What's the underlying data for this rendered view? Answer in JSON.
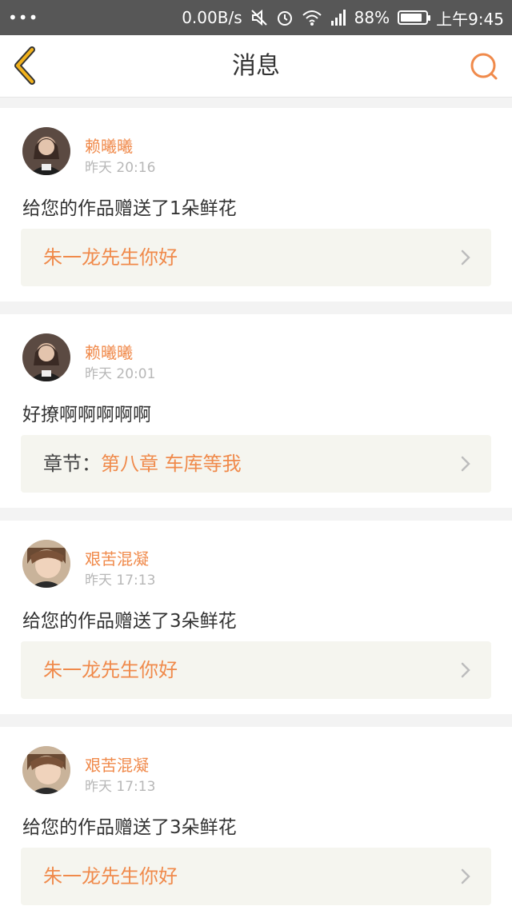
{
  "status_bar": {
    "dots": "•••",
    "network_speed": "0.00B/s",
    "battery_percent": "88%",
    "battery_level": 0.88,
    "time": "上午9:45"
  },
  "header": {
    "title": "消息"
  },
  "colors": {
    "accent": "#f08a4b",
    "back_arrow": "#f2b21c"
  },
  "messages": [
    {
      "username": "赖曦曦",
      "time": "昨天 20:16",
      "text": "给您的作品赠送了1朵鲜花",
      "ref_prefix": "",
      "ref_text": "朱一龙先生你好"
    },
    {
      "username": "赖曦曦",
      "time": "昨天 20:01",
      "text": "好撩啊啊啊啊啊",
      "ref_prefix": "章节：",
      "ref_text": "第八章 车库等我"
    },
    {
      "username": "艰苦混凝",
      "time": "昨天 17:13",
      "text": "给您的作品赠送了3朵鲜花",
      "ref_prefix": "",
      "ref_text": "朱一龙先生你好"
    },
    {
      "username": "艰苦混凝",
      "time": "昨天 17:13",
      "text": "给您的作品赠送了3朵鲜花",
      "ref_prefix": "",
      "ref_text": "朱一龙先生你好"
    }
  ]
}
